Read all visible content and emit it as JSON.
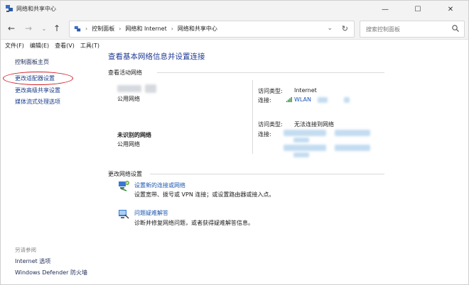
{
  "window": {
    "title": "网络和共享中心",
    "controls": {
      "minimize": "—",
      "maximize": "☐",
      "close": "✕"
    }
  },
  "address": {
    "crumbs": [
      "控制面板",
      "网络和 Internet",
      "网络和共享中心"
    ],
    "search_placeholder": "搜索控制面板"
  },
  "menu": [
    "文件(F)",
    "编辑(E)",
    "查看(V)",
    "工具(T)"
  ],
  "sidebar": {
    "items": [
      "控制面板主页",
      "更改适配器设置",
      "更改高级共享设置",
      "媒体流式处理选项"
    ],
    "see_also_title": "另请参阅",
    "see_also": [
      "Internet 选项",
      "Windows Defender 防火墙"
    ]
  },
  "main": {
    "title": "查看基本网络信息并设置连接",
    "active_networks_header": "查看活动网络",
    "networks": [
      {
        "name": "",
        "type": "公用网络",
        "access_label": "访问类型:",
        "access_value": "Internet",
        "conn_label": "连接:",
        "conn_value": "WLAN"
      },
      {
        "name": "未识别的网络",
        "type": "公用网络",
        "access_label": "访问类型:",
        "access_value": "无法连接到网络",
        "conn_label": "连接:",
        "conn_value": ""
      }
    ],
    "change_header": "更改网络设置",
    "tasks": [
      {
        "title": "设置新的连接或网络",
        "desc": "设置宽带、拨号或 VPN 连接；或设置路由器或接入点。"
      },
      {
        "title": "问题疑难解答",
        "desc": "诊断并修复网络问题，或者获得疑难解答信息。"
      }
    ]
  },
  "colors": {
    "link": "#1a57b0",
    "title": "#1f3a93",
    "highlight": "#d21e25"
  }
}
